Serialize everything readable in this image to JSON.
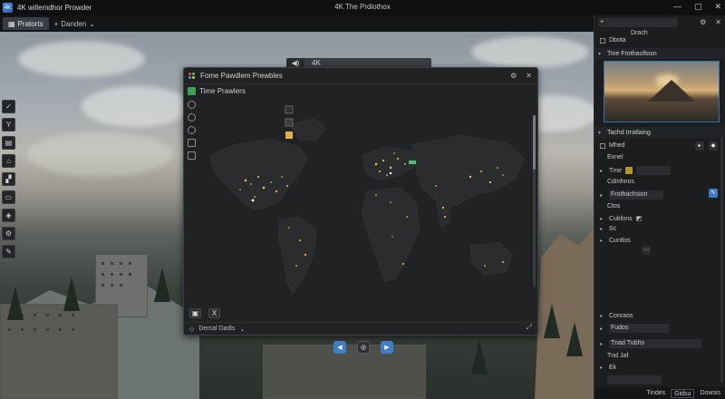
{
  "app": {
    "logo_text": "4K",
    "title": "4K willemdhor Prowder",
    "window_title": "4K The Prdiothox"
  },
  "window_controls": {
    "minimize": "—",
    "maximize": "▢",
    "close": "✕"
  },
  "tabs": {
    "active": "Pratorts",
    "second": "Danden"
  },
  "chip": {
    "volume_icon": "◀)",
    "label": "4K"
  },
  "left_tools": [
    "✓",
    "Y",
    "▤",
    "⌂",
    "▞",
    "▭",
    "◈",
    "⚙",
    "✎"
  ],
  "map_window": {
    "title": "Fome Pawdlem Prewbles",
    "subtitle": "Time Prawlers",
    "footer_label": "Dercal Dadls",
    "camera_tools": [
      "▣",
      "X"
    ]
  },
  "playback": {
    "prev": "◀",
    "center": "◎",
    "next": "▶"
  },
  "right_panel": {
    "search_value": "+",
    "brand": "Drach",
    "dots_label": "Dbota",
    "time_section": "Tine Frothauftosn",
    "toolset_section": "Tachd Irratlaing",
    "items": {
      "mhed": "Mhed",
      "exnel": "Exnel",
      "tme": "Tme",
      "cdmhnos": "Cdmhnos",
      "frothachsion": "Frothachsion",
      "ctos": "Ctos",
      "cukfons": "Cukfons",
      "sc": "Sc",
      "cuntlos": "Cuntlos",
      "conraos": "Conraos",
      "fudos": "Fudos",
      "trad_tubhs": "Tnad Tubhs",
      "tnd_jaf": "Tnd Jaf",
      "ek": "Ek"
    },
    "footer": {
      "left": "Tindes",
      "mid": "Gidsu",
      "right": "Dowsis"
    }
  },
  "colors": {
    "accent_blue": "#3f7ec4",
    "map_dark": "#212224",
    "city_lights": "#f2c14e"
  }
}
